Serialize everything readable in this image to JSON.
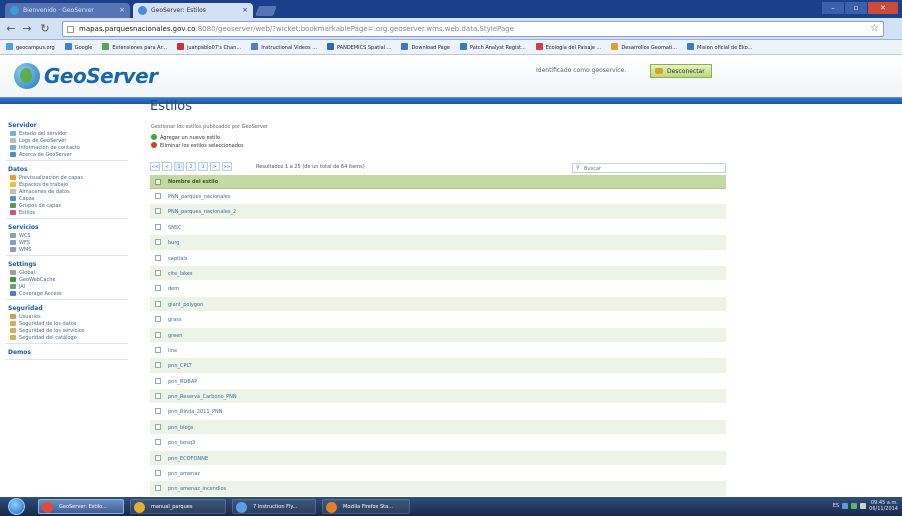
{
  "browser": {
    "tabs": [
      {
        "label": "Bienvenido · GeoServer"
      },
      {
        "label": "GeoServer: Estilos"
      }
    ],
    "url_host": "mapas.parquesnacionales.gov.co",
    "url_rest": ":8080/geoserver/web/?wicket:bookmarkablePage=:org.geoserver.wms.web.data.StylePage",
    "bookmarks": [
      {
        "label": "geocampus.org",
        "color": "#4aa3df"
      },
      {
        "label": "Google",
        "color": "#3b7ee8"
      },
      {
        "label": "Extensiones para Ar...",
        "color": "#5aa35a"
      },
      {
        "label": "juanpablo07's Chan...",
        "color": "#d03030"
      },
      {
        "label": "Instructional Videos ...",
        "color": "#5080c0"
      },
      {
        "label": "PANDEMICS Spatial ...",
        "color": "#2a6ab0"
      },
      {
        "label": "Download Page",
        "color": "#3a78c8"
      },
      {
        "label": "Patch Analyst Regist...",
        "color": "#3a78c8"
      },
      {
        "label": "Ecología del Paisaje ...",
        "color": "#d04040"
      },
      {
        "label": "Desarrollos Geomati...",
        "color": "#e0a030"
      },
      {
        "label": "Mision oficial de Eko...",
        "color": "#3a78c8"
      }
    ]
  },
  "header": {
    "logo_text": "GeoServer",
    "logged_in_text": "Identificado como geoservice.",
    "login_button": "Desconectar"
  },
  "sidebar": {
    "sections": [
      {
        "title": "Servidor",
        "items": [
          {
            "label": "Estado del servidor",
            "color": "#7ab0d8"
          },
          {
            "label": "Logs de GeoServer",
            "color": "#bbbbbb"
          },
          {
            "label": "Información de contacto",
            "color": "#7ab0d8"
          },
          {
            "label": "Acerca de GeoServer",
            "color": "#4a90d0"
          }
        ]
      },
      {
        "title": "Datos",
        "items": [
          {
            "label": "Previsualización de capas",
            "color": "#e0a030"
          },
          {
            "label": "Espacios de trabajo",
            "color": "#e8c040"
          },
          {
            "label": "Almacenes de datos",
            "color": "#c0c0c0"
          },
          {
            "label": "Capas",
            "color": "#5a8ad0"
          },
          {
            "label": "Grupos de capas",
            "color": "#50a050"
          },
          {
            "label": "Estilos",
            "color": "#d05090"
          }
        ]
      },
      {
        "title": "Servicios",
        "items": [
          {
            "label": "WCS",
            "color": "#8aa0b8"
          },
          {
            "label": "WFS",
            "color": "#8aa0b8"
          },
          {
            "label": "WMS",
            "color": "#8aa0b8"
          }
        ]
      },
      {
        "title": "Settings",
        "items": [
          {
            "label": "Global",
            "color": "#a0a0a0"
          },
          {
            "label": "GeoWebCache",
            "color": "#3a9a3a"
          },
          {
            "label": "JAI",
            "color": "#70a070"
          },
          {
            "label": "Coverage Access",
            "color": "#5080c0"
          }
        ]
      },
      {
        "title": "Seguridad",
        "items": [
          {
            "label": "Usuarios",
            "color": "#d0a050"
          },
          {
            "label": "Seguridad de los datos",
            "color": "#d0b060"
          },
          {
            "label": "Seguridad de los servicios",
            "color": "#d0b060"
          },
          {
            "label": "Seguridad del catálogo",
            "color": "#d0b060"
          }
        ]
      },
      {
        "title": "Demos",
        "items": []
      }
    ]
  },
  "main": {
    "title": "Estilos",
    "intro": "Gestionar los estilos publicados por GeoServer",
    "add_action": "Agregar un nuevo estilo",
    "remove_action": "Eliminar los estilos seleccionados",
    "pager": [
      "<<",
      "<",
      "1",
      "2",
      "3",
      ">",
      ">>"
    ],
    "results": "Resultados 1 a 25 (de un total de 64 ítems)",
    "search_placeholder": "Buscar",
    "table_header": "Nombre del estilo",
    "styles": [
      "PNN_parques_nacionales",
      "PNN_parques_nacionales_2",
      "SNSC",
      "burg",
      "capitals",
      "cite_lakes",
      "dem",
      "giant_polygon",
      "grass",
      "green",
      "line",
      "pnn_CPLT",
      "pnn_ROBAP",
      "pnn_Reserva_Carbono_PNN",
      "pnn_Rinda_2011_PNN",
      "pnn_biogs",
      "pnn_bosq3",
      "pnn_ECOFONNE",
      "pnn_amenaz",
      "pnn_amenaz_incendios"
    ]
  },
  "taskbar": {
    "tasks": [
      {
        "label": "GeoServer: Estilo...",
        "color": "#e04a3a",
        "active": true
      },
      {
        "label": "manual_parques",
        "color": "#e0b030",
        "active": false
      },
      {
        "label": "7 Instruction Fly...",
        "color": "#5aa0e0",
        "active": false
      },
      {
        "label": "Mozilla Firefox Sta...",
        "color": "#e0802a",
        "active": false
      }
    ],
    "language": "ES",
    "time": "09:45 a.m.",
    "date": "06/11/2014"
  }
}
